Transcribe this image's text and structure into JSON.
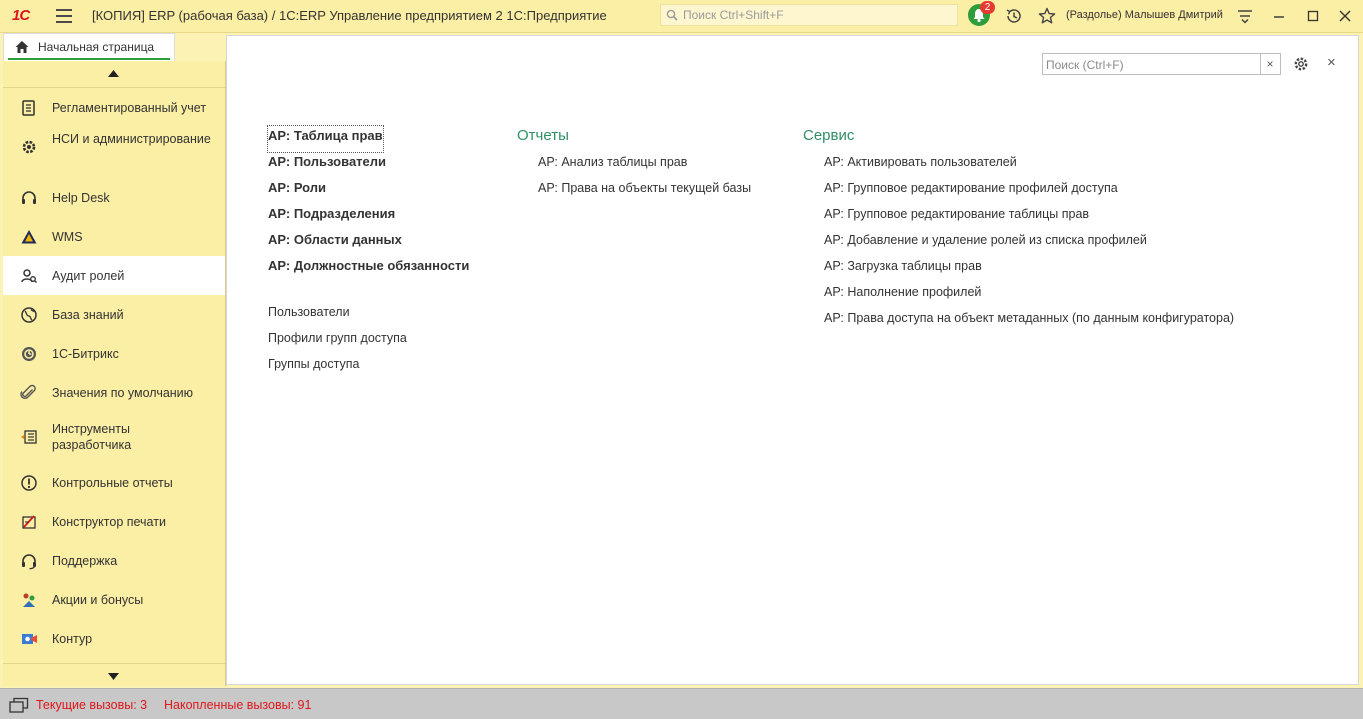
{
  "app": {
    "logo_text": "1С",
    "window_title": "[КОПИЯ] ERP (рабочая база) / 1С:ERP Управление предприятием 2 1С:Предприятие",
    "search_placeholder": "Поиск Ctrl+Shift+F",
    "notifications_count": "2",
    "user": "(Раздолье) Малышев Дмитрий"
  },
  "tabs": {
    "home_label": "Начальная страница"
  },
  "sidebar": {
    "items": [
      {
        "label": "Регламентированный учет",
        "icon": "ledger-icon"
      },
      {
        "label": "НСИ и администрирование",
        "icon": "gear-icon"
      },
      {
        "label": "Help Desk",
        "icon": "headset-icon"
      },
      {
        "label": "WMS",
        "icon": "warning-triangle-icon"
      },
      {
        "label": "Аудит ролей",
        "icon": "users-audit-icon",
        "active": true
      },
      {
        "label": "База знаний",
        "icon": "globe-icon"
      },
      {
        "label": "1С-Битрикс",
        "icon": "bitrix-icon"
      },
      {
        "label": "Значения по умолчанию",
        "icon": "paperclip-icon"
      },
      {
        "label": "Инструменты разработчика",
        "icon": "dev-tools-icon"
      },
      {
        "label": "Контрольные отчеты",
        "icon": "exclamation-icon"
      },
      {
        "label": "Конструктор печати",
        "icon": "print-designer-icon"
      },
      {
        "label": "Поддержка",
        "icon": "support-headset-icon"
      },
      {
        "label": "Акции и бонусы",
        "icon": "promo-icon"
      },
      {
        "label": "Контур",
        "icon": "kontur-icon"
      }
    ]
  },
  "panel": {
    "search_placeholder": "Поиск (Ctrl+F)",
    "clear_label": "×",
    "close_label": "×",
    "main_links": [
      "АР: Таблица прав",
      "АР: Пользователи",
      "АР: Роли",
      "АР: Подразделения",
      "АР: Области данных",
      "АР: Должностные обязанности"
    ],
    "secondary_links": [
      "Пользователи",
      "Профили групп доступа",
      "Группы доступа"
    ],
    "reports": {
      "title": "Отчеты",
      "items": [
        "АР: Анализ таблицы прав",
        "АР: Права на объекты текущей базы"
      ]
    },
    "service": {
      "title": "Сервис",
      "items": [
        "АР: Активировать пользователей",
        "АР: Групповое редактирование профилей доступа",
        "АР: Групповое редактирование таблицы прав",
        "АР: Добавление и удаление ролей из списка профилей",
        "АР: Загрузка таблицы прав",
        "АР: Наполнение профилей",
        "АР: Права доступа на объект метаданных (по данным конфигуратора)"
      ]
    }
  },
  "status": {
    "current_calls": "Текущие вызовы: 3",
    "accumulated_calls": "Накопленные вызовы: 91"
  },
  "colors": {
    "accent_green": "#2e9e3a",
    "section_heading": "#2f8f64",
    "status_red": "#e0161b",
    "sidebar_bg": "#fbeea5"
  }
}
